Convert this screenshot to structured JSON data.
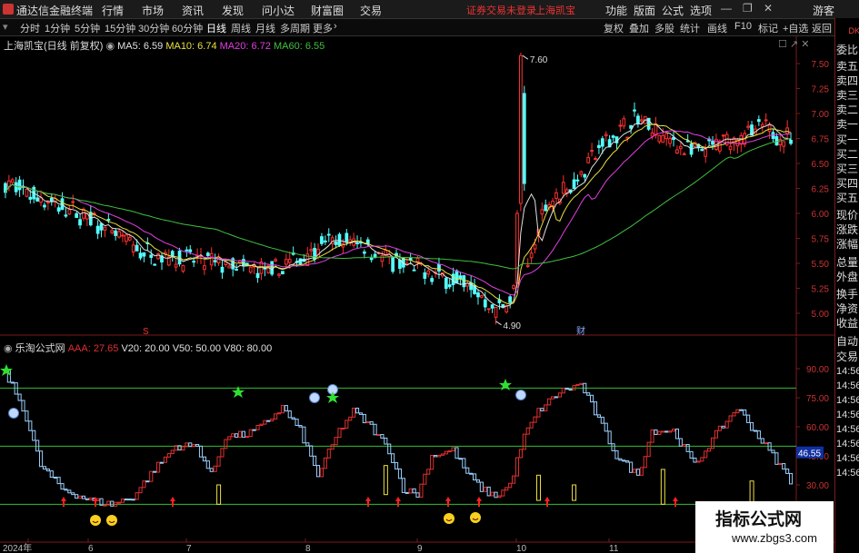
{
  "app": {
    "title": "通达信金融终端",
    "menu": [
      "行情",
      "市场",
      "资讯",
      "发现",
      "问小达",
      "财富圈",
      "交易"
    ],
    "notice": "证券交易未登录",
    "stock_name_top": "上海凯宝",
    "right_menu": [
      "功能",
      "版面",
      "公式",
      "选项"
    ],
    "guest": "游客"
  },
  "toolbar": {
    "periods": [
      "分时",
      "1分钟",
      "5分钟",
      "15分钟",
      "30分钟",
      "60分钟",
      "日线",
      "周线",
      "月线",
      "多周期",
      "更多"
    ],
    "active_period": "日线",
    "right_buttons": [
      "复权",
      "叠加",
      "多股",
      "统计",
      "画线",
      "F10",
      "标记",
      "+自选",
      "返回"
    ]
  },
  "price_chart": {
    "legend_title": "上海凯宝(日线 前复权)",
    "ma": [
      {
        "label": "MA5: 6.59",
        "color": "#e0e0e0"
      },
      {
        "label": "MA10: 6.74",
        "color": "#e8e040"
      },
      {
        "label": "MA20: 6.72",
        "color": "#e040e0"
      },
      {
        "label": "MA60: 6.55",
        "color": "#40c040"
      }
    ],
    "y_ticks": [
      "7.50",
      "7.25",
      "7.00",
      "6.75",
      "6.50",
      "6.25",
      "6.00",
      "5.75",
      "5.50",
      "5.25",
      "5.00"
    ],
    "high_label": "7.60",
    "low_label": "4.90",
    "marker_s": "S",
    "marker_cai": "财"
  },
  "indicator_chart": {
    "name": "乐淘公式网",
    "params": [
      {
        "label": "AAA: 27.65",
        "color": "#e03030"
      },
      {
        "label": "V20: 20.00",
        "color": "#e0e0e0"
      },
      {
        "label": "V50: 50.00",
        "color": "#e0e0e0"
      },
      {
        "label": "V80: 80.00",
        "color": "#e0e0e0"
      }
    ],
    "y_ticks": [
      "90.00",
      "75.00",
      "60.00",
      "45.00",
      "30.00"
    ],
    "current_value": "46.55"
  },
  "x_axis": [
    "2024年",
    "6",
    "7",
    "8",
    "9",
    "10",
    "11"
  ],
  "right_panel": {
    "top_label": "DK",
    "items": [
      "委比",
      "卖五",
      "卖四",
      "卖三",
      "卖二",
      "卖一",
      "买一",
      "买二",
      "买三",
      "买四",
      "买五",
      "现价",
      "涨跌",
      "涨幅",
      "总量",
      "外盘",
      "换手",
      "净资",
      "收益",
      "自动",
      "交易"
    ],
    "times": [
      "14:56",
      "14:56",
      "14:56",
      "14:56",
      "14:56",
      "14:56",
      "14:56",
      "14:56"
    ]
  },
  "watermark": {
    "line1": "指标公式网",
    "line2": "www.zbgs3.com"
  }
}
